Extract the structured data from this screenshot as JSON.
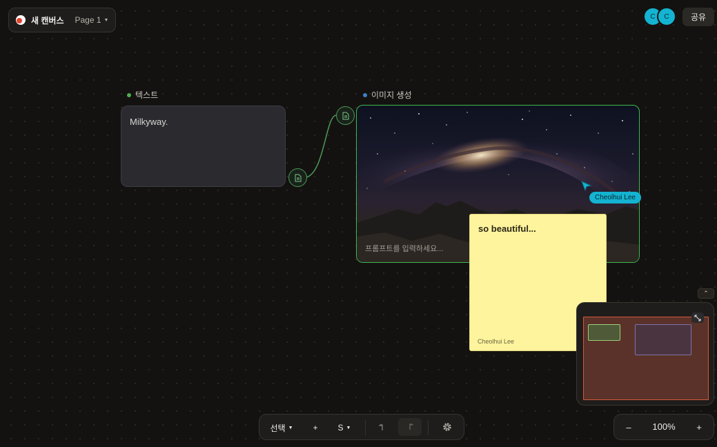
{
  "header": {
    "canvas_title": "새 캔버스",
    "page_selector": "Page 1"
  },
  "collaborators": [
    {
      "initial": "C"
    },
    {
      "initial": "C"
    }
  ],
  "share_label": "공유",
  "nodes": {
    "text_node": {
      "label": "텍스트",
      "content": "Milkyway."
    },
    "image_node": {
      "label": "이미지 생성",
      "prompt_placeholder": "프롬프트를 입력하세요..."
    }
  },
  "remote_cursor": {
    "user": "Cheolhui Lee"
  },
  "sticky_note": {
    "text": "so beautiful...",
    "author": "Cheolhui Lee"
  },
  "toolbar": {
    "select_label": "선택",
    "add_label": "+",
    "size_label": "S"
  },
  "zoom": {
    "decrease_label": "–",
    "value": "100%",
    "increase_label": "+"
  },
  "colors": {
    "accent_green": "#3fb950",
    "collaborator_cyan": "#14b3d1",
    "sticky_yellow": "#fdf49d",
    "text_node_dot": "#4caf50",
    "image_node_dot": "#3b82c4"
  }
}
